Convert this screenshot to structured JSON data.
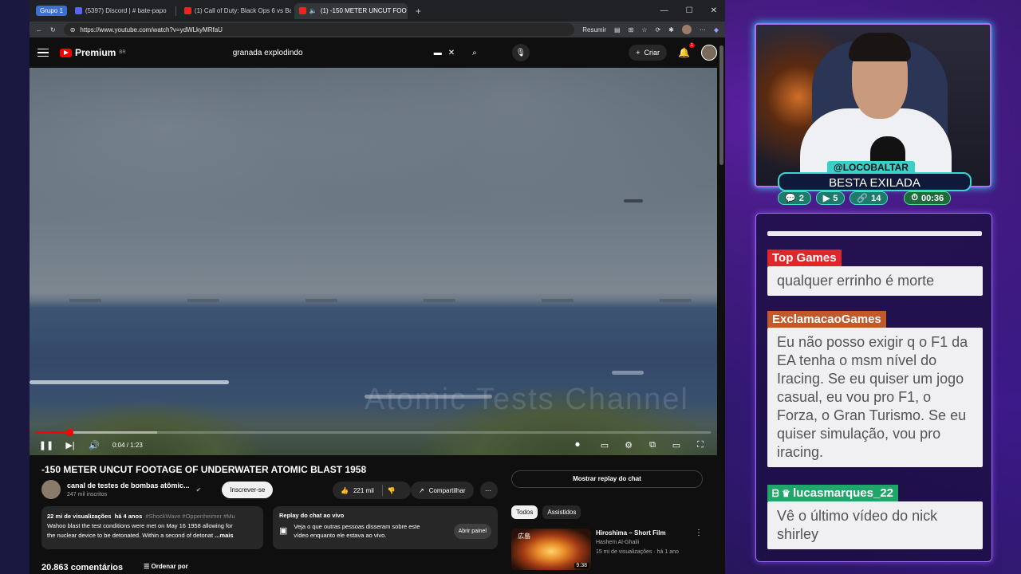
{
  "browser": {
    "tab_group": "Grupo 1",
    "tabs": [
      {
        "label": "(5397) Discord | # bate-papo",
        "icon": "discord-icon",
        "active": false
      },
      {
        "label": "(1) Call of Duty: Black Ops 6 vs Bat",
        "icon": "youtube-icon",
        "active": false
      },
      {
        "label": "(1) -150 METER UNCUT FOO",
        "icon": "youtube-icon",
        "active": true
      }
    ],
    "url": "https://www.youtube.com/watch?v=ydWLkyMRfaU",
    "resumir": "Resumir"
  },
  "youtube": {
    "logo": "Premium",
    "region": "BR",
    "search_query": "granada explodindo",
    "create_label": "Criar",
    "notifications": "1"
  },
  "video": {
    "time": "0:04 / 1:23",
    "progress_fraction": 0.05,
    "buffered_fraction": 0.18,
    "watermark": "Atomic Tests Channel",
    "title": "-150 METER UNCUT FOOTAGE OF UNDERWATER ATOMIC BLAST 1958",
    "channel": "canal de testes de bombas atômic...",
    "subscribers": "247 mil inscritos",
    "subscribe_label": "Inscrever-se",
    "likes": "221 mil",
    "share_label": "Compartilhar",
    "views": "22 mi de visualizações",
    "age": "há 4 anos",
    "tags": "#ShockWave #Oppenheimer #Mu",
    "description_line1": "Wahoo blast the test conditions were met on May 16 1958 allowing for",
    "description_line2": "the nuclear device to be detonated. Within a second of detonat",
    "more_label": "...mais",
    "replay_title": "Replay do chat ao vivo",
    "replay_text_1": "Veja o que outras pessoas disseram sobre este",
    "replay_text_2": "vídeo enquanto ele estava ao vivo.",
    "replay_open": "Abrir painel",
    "comments_count": "20.863 comentários",
    "sort_label": "Ordenar por",
    "show_chat_replay": "Mostrar replay do chat",
    "filters": [
      "Todos",
      "Assistidos"
    ],
    "rec_title": "Hiroshima – Short Film",
    "rec_channel": "Hashem Al-Ghaili",
    "rec_meta": "15 mi de visualizações · há 1 ano",
    "rec_duration": "9:38",
    "rec_thumb_text": "広島"
  },
  "stream": {
    "handle": "@LOCOBALTAR",
    "title": "BESTA EXILADA",
    "stat_chat": "2",
    "stat_video": "5",
    "stat_link": "14",
    "stat_time": "00:36"
  },
  "chat": [
    {
      "user": "Top Games",
      "color": "#e0262d",
      "text": "qualquer errinho é morte"
    },
    {
      "user": "ExclamacaoGames",
      "color": "#c2592a",
      "text": "Eu não posso exigir q o F1 da EA tenha o msm nível do Iracing. Se eu quiser um jogo casual, eu vou pro F1, o Forza, o Gran Turismo. Se eu quiser simulação, vou pro iracing."
    },
    {
      "user": "lucasmarques_22",
      "color": "#1fa66a",
      "text": "Vê o último vídeo do nick shirley"
    }
  ]
}
